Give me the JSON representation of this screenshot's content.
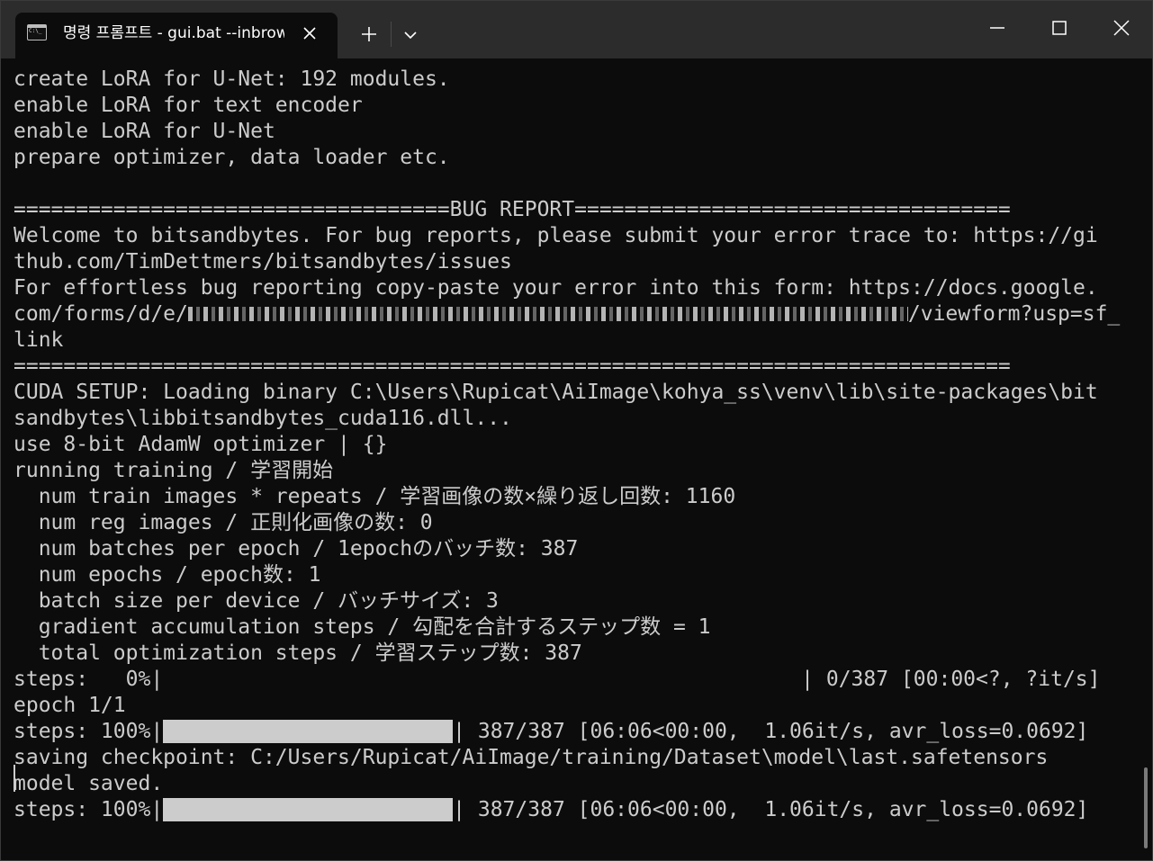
{
  "window": {
    "tab_title": "명령 프롬프트 - gui.bat --inbrowser",
    "new_tab_label": "+",
    "colors": {
      "titlebar": "#2c2c2c",
      "background": "#0c0c0c",
      "text": "#cccccc"
    }
  },
  "console": {
    "lines": [
      "create LoRA for U-Net: 192 modules.",
      "enable LoRA for text encoder",
      "enable LoRA for U-Net",
      "prepare optimizer, data loader etc.",
      "",
      "===================================BUG REPORT===================================",
      "Welcome to bitsandbytes. For bug reports, please submit your error trace to: https://gi",
      "thub.com/TimDettmers/bitsandbytes/issues",
      "For effortless bug reporting copy-paste your error into this form: https://docs.google.",
      "com/forms/d/e/",
      "link",
      "================================================================================",
      "CUDA SETUP: Loading binary C:\\Users\\Rupicat\\AiImage\\kohya_ss\\venv\\lib\\site-packages\\bit",
      "sandbytes\\libbitsandbytes_cuda116.dll...",
      "use 8-bit AdamW optimizer | {}",
      "running training / 学習開始",
      "  num train images * repeats / 学習画像の数×繰り返し回数: 1160",
      "  num reg images / 正則化画像の数: 0",
      "  num batches per epoch / 1epochのバッチ数: 387",
      "  num epochs / epoch数: 1",
      "  batch size per device / バッチサイズ: 3",
      "  gradient accumulation steps / 勾配を合計するステップ数 = 1",
      "  total optimization steps / 学習ステップ数: 387",
      "epoch 1/1",
      "saving checkpoint: C:/Users/Rupicat/AiImage/training/Dataset\\model\\last.safetensors",
      "model saved."
    ],
    "redacted_url_suffix": "/viewform?usp=sf_",
    "progress": [
      {
        "prefix": "steps:   0%|",
        "fraction": 0.0,
        "suffix": "| 0/387 [00:00<?, ?it/s]"
      },
      {
        "prefix": "steps: 100%|",
        "fraction": 1.0,
        "suffix": "| 387/387 [06:06<00:00,  1.06it/s, avr_loss=0.0692]"
      },
      {
        "prefix": "steps: 100%|",
        "fraction": 1.0,
        "suffix": "| 387/387 [06:06<00:00,  1.06it/s, avr_loss=0.0692]"
      }
    ]
  }
}
